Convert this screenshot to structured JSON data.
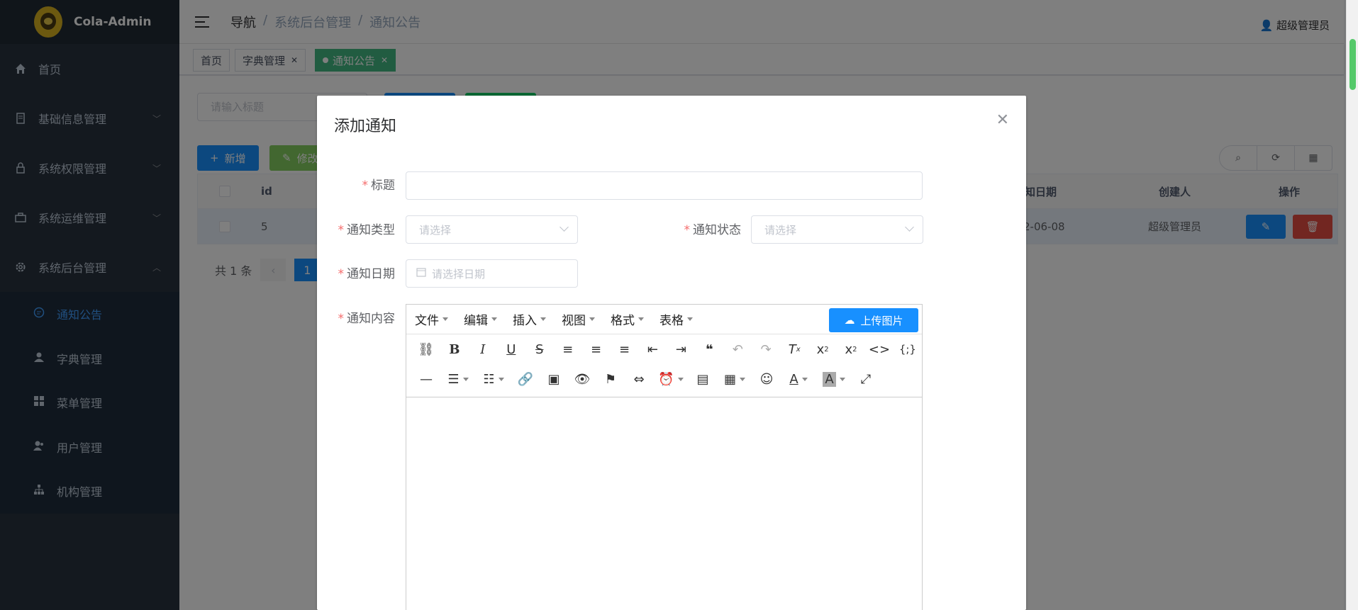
{
  "sidebar": {
    "logo_text": "Cola-Admin",
    "items": [
      {
        "label": "首页",
        "icon": "home-icon"
      },
      {
        "label": "基础信息管理",
        "icon": "document-icon"
      },
      {
        "label": "系统权限管理",
        "icon": "lock-icon"
      },
      {
        "label": "系统运维管理",
        "icon": "briefcase-icon"
      },
      {
        "label": "系统后台管理",
        "icon": "gear-icon"
      }
    ],
    "subitems": [
      {
        "label": "通知公告",
        "icon": "message-icon"
      },
      {
        "label": "字典管理",
        "icon": "user-icon"
      },
      {
        "label": "菜单管理",
        "icon": "grid-icon"
      },
      {
        "label": "用户管理",
        "icon": "users-icon"
      },
      {
        "label": "机构管理",
        "icon": "org-icon"
      }
    ]
  },
  "header": {
    "breadcrumb": [
      "导航",
      "系统后台管理",
      "通知公告"
    ],
    "user": "超级管理员"
  },
  "tags": [
    {
      "label": "首页"
    },
    {
      "label": "字典管理"
    },
    {
      "label": "通知公告"
    }
  ],
  "main": {
    "search_placeholder": "请输入标题",
    "add_label": "新增",
    "edit_label": "修改",
    "table_headers": {
      "id": "id",
      "date": "知日期",
      "creator": "创建人",
      "ops": "操作"
    },
    "row": {
      "id": "5",
      "date": "2-06-08",
      "creator": "超级管理员"
    },
    "pager_total": "共 1 条",
    "pager_page": "1"
  },
  "dialog": {
    "title": "添加通知",
    "title_label": "标题",
    "type_label": "通知类型",
    "type_placeholder": "请选择",
    "status_label": "通知状态",
    "status_placeholder": "请选择",
    "date_label": "通知日期",
    "date_placeholder": "请选择日期",
    "content_label": "通知内容",
    "menus": [
      "文件",
      "编辑",
      "插入",
      "视图",
      "格式",
      "表格"
    ],
    "upload_label": "上传图片"
  },
  "colors": {
    "sidebar": "#28323f",
    "active": "#409eff",
    "tag_active": "#42b983",
    "primary": "#1890ff",
    "danger": "#e54d42"
  }
}
